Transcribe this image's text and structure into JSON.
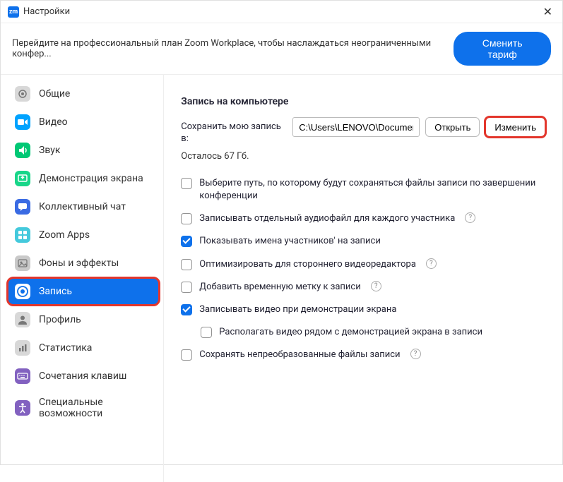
{
  "titlebar": {
    "app_label": "zm",
    "title": "Настройки"
  },
  "promo": {
    "text": "Перейдите на профессиональный план Zoom Workplace, чтобы наслаждаться неограниченными конфер...",
    "button": "Сменить тариф"
  },
  "sidebar": {
    "items": [
      {
        "label": "Общие",
        "icon": "gear",
        "color": "#d8d8d8",
        "active": false
      },
      {
        "label": "Видео",
        "icon": "video",
        "color": "#00a3ff",
        "active": false
      },
      {
        "label": "Звук",
        "icon": "audio",
        "color": "#00c875",
        "active": false
      },
      {
        "label": "Демонстрация экрана",
        "icon": "share",
        "color": "#18d689",
        "active": false
      },
      {
        "label": "Коллективный чат",
        "icon": "chat",
        "color": "#3a6be3",
        "active": false
      },
      {
        "label": "Zoom Apps",
        "icon": "apps",
        "color": "#44c9dc",
        "active": false
      },
      {
        "label": "Фоны и эффекты",
        "icon": "background",
        "color": "#c9c9c9",
        "active": false
      },
      {
        "label": "Запись",
        "icon": "record",
        "color": "#ffffff",
        "active": true,
        "highlighted": true
      },
      {
        "label": "Профиль",
        "icon": "profile",
        "color": "#d8d8d8",
        "active": false
      },
      {
        "label": "Статистика",
        "icon": "stats",
        "color": "#d8d8d8",
        "active": false
      },
      {
        "label": "Сочетания клавиш",
        "icon": "keyboard",
        "color": "#8261c0",
        "active": false
      },
      {
        "label": "Специальные возможности",
        "icon": "accessibility",
        "color": "#8261c0",
        "active": false
      }
    ]
  },
  "main": {
    "section_title": "Запись на компьютере",
    "path_label": "Сохранить мою запись в:",
    "path_value": "C:\\Users\\LENOVO\\Documents\\Z",
    "open_button": "Открыть",
    "change_button": "Изменить",
    "remaining": "Осталось 67 Гб.",
    "options": [
      {
        "label": "Выберите путь, по которому будут сохраняться файлы записи по завершении конференции",
        "checked": false,
        "help": false,
        "indent": false
      },
      {
        "label": "Записывать отдельный аудиофайл для каждого участника",
        "checked": false,
        "help": true,
        "indent": false
      },
      {
        "label": "Показывать имена участников' на записи",
        "checked": true,
        "help": false,
        "indent": false
      },
      {
        "label": "Оптимизировать для стороннего видеоредактора",
        "checked": false,
        "help": true,
        "indent": false
      },
      {
        "label": "Добавить временную метку к записи",
        "checked": false,
        "help": true,
        "indent": false
      },
      {
        "label": "Записывать видео при демонстрации экрана",
        "checked": true,
        "help": false,
        "indent": false
      },
      {
        "label": "Располагать видео рядом с демонстрацией экрана в записи",
        "checked": false,
        "help": false,
        "indent": true
      },
      {
        "label": "Сохранять непреобразованные файлы записи",
        "checked": false,
        "help": true,
        "indent": false
      }
    ]
  }
}
